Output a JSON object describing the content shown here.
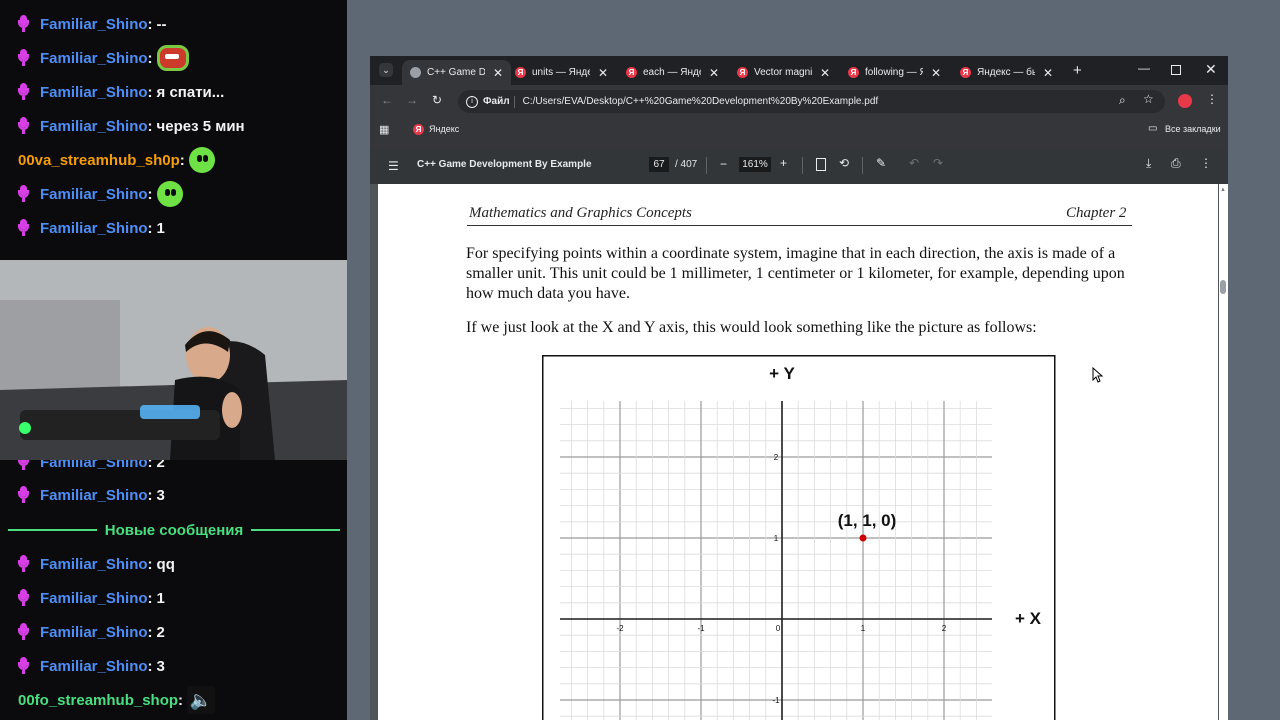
{
  "chat": {
    "messages": [
      {
        "nick": "Familiar_Shino",
        "text": "--",
        "nick_color": "blue",
        "mic": true
      },
      {
        "nick": "Familiar_Shino",
        "text": "",
        "nick_color": "blue",
        "mic": true,
        "emote": "face"
      },
      {
        "nick": "Familiar_Shino",
        "text": "я спати...",
        "nick_color": "blue",
        "mic": true
      },
      {
        "nick": "Familiar_Shino",
        "text": "через 5 мин",
        "nick_color": "blue",
        "mic": true
      },
      {
        "nick": "00va_streamhub_sh0p",
        "text": "",
        "nick_color": "orange",
        "mic": false,
        "emote": "green"
      },
      {
        "nick": "Familiar_Shino",
        "text": "",
        "nick_color": "blue",
        "mic": true,
        "emote": "green"
      },
      {
        "nick": "Familiar_Shino",
        "text": "1",
        "nick_color": "blue",
        "mic": true
      },
      {
        "nick": "Familiar_Shino",
        "text": "2",
        "nick_color": "blue",
        "mic": true
      },
      {
        "nick": "Familiar_Shino",
        "text": "3",
        "nick_color": "blue",
        "mic": true
      }
    ],
    "divider_label": "Новые сообщения",
    "new_messages": [
      {
        "nick": "Familiar_Shino",
        "text": "qq",
        "nick_color": "blue",
        "mic": true
      },
      {
        "nick": "Familiar_Shino",
        "text": "1",
        "nick_color": "blue",
        "mic": true
      },
      {
        "nick": "Familiar_Shino",
        "text": "2",
        "nick_color": "blue",
        "mic": true
      },
      {
        "nick": "Familiar_Shino",
        "text": "3",
        "nick_color": "blue",
        "mic": true
      },
      {
        "nick": "00fo_streamhub_shop",
        "text": "",
        "nick_color": "green",
        "mic": false,
        "emote": "speaker"
      }
    ]
  },
  "browser": {
    "tabs": [
      {
        "label": "C++ Game Dev",
        "active": true,
        "favicon": "globe-icon"
      },
      {
        "label": "units — Яндекс",
        "active": false,
        "favicon": "yandex-icon"
      },
      {
        "label": "each — Яндекс",
        "active": false,
        "favicon": "yandex-icon"
      },
      {
        "label": "Vector magnitude",
        "active": false,
        "favicon": "yandex-icon"
      },
      {
        "label": "following — Яндекс",
        "active": false,
        "favicon": "yandex-icon"
      },
      {
        "label": "Яндекс — быстрый",
        "active": false,
        "favicon": "yandex-icon"
      }
    ],
    "omnibox": {
      "scheme_label": "Файл",
      "url": "C:/Users/EVA/Desktop/C++%20Game%20Development%20By%20Example.pdf"
    },
    "bookmarks": {
      "item": "Яндекс",
      "all_bookmarks": "Все закладки"
    },
    "pdf": {
      "title": "C++ Game Development By Example",
      "page_current": "67",
      "page_total": "/ 407",
      "zoom": "161%"
    }
  },
  "document": {
    "header_left": "Mathematics and Graphics Concepts",
    "header_right": "Chapter 2",
    "paragraph1": "For specifying points within a coordinate system, imagine that in each direction, the axis is made of a smaller unit. This unit could be 1 millimeter, 1 centimeter or 1 kilometer, for example, depending upon how much data you have.",
    "paragraph2": "If we just look at the X and Y axis, this would look something like the picture as follows:",
    "figure": {
      "y_axis_label": "+ Y",
      "x_axis_label": "+ X",
      "point_label": "(1, 1, 0)",
      "point": {
        "x": 1,
        "y": 1
      },
      "x_ticks": [
        "-2",
        "-1",
        "0",
        "1",
        "2"
      ],
      "y_ticks": [
        "2",
        "1",
        "-1"
      ],
      "point_color": "#cc0000"
    }
  }
}
